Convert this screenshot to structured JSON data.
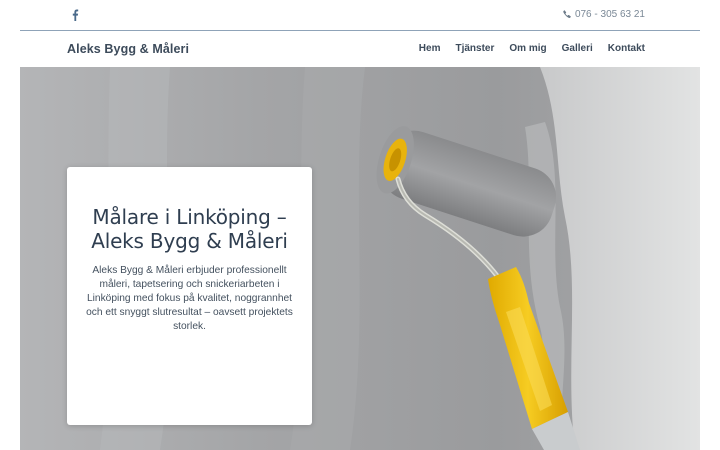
{
  "topbar": {
    "social_icon": "facebook-icon",
    "phone_icon": "phone-icon",
    "phone": "076 - 305 63 21"
  },
  "navbar": {
    "brand": "Aleks Bygg & Måleri",
    "menu": [
      "Hem",
      "Tjänster",
      "Om mig",
      "Galleri",
      "Kontakt"
    ]
  },
  "hero": {
    "image": "paint-roller-on-grey-wall",
    "title": "Målare i Linköping – Aleks Bygg & Måleri",
    "text": "Aleks Bygg & Måleri erbjuder professionellt måleri, tapetsering och snickeriarbeten i Linköping med fokus på kvalitet, noggrannhet och ett snyggt slutresultat – oavsett projektets storlek."
  },
  "colors": {
    "text_dark": "#3d4b5b",
    "roller_handle": "#f2c21a",
    "wall_grey": "#9b9c9e",
    "divider": "#8fa3b8"
  }
}
